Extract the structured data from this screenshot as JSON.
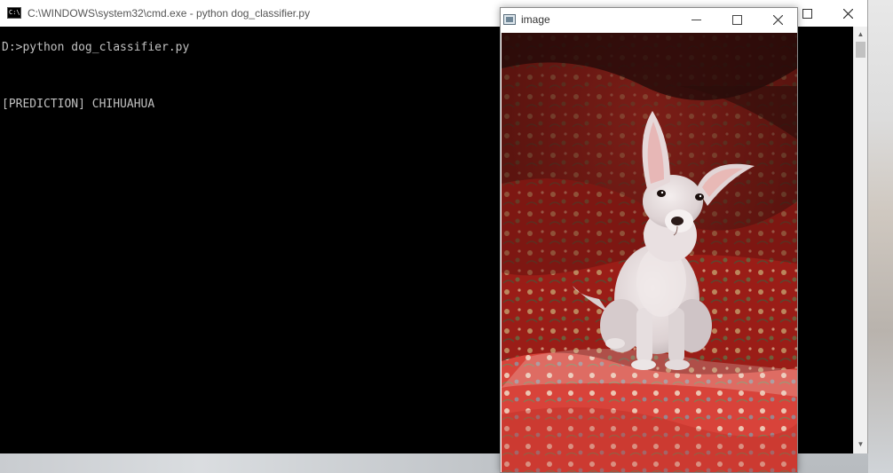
{
  "cmd_window": {
    "title": "C:\\WINDOWS\\system32\\cmd.exe - python  dog_classifier.py",
    "icon_text": "C:\\.",
    "lines": [
      "D:>python dog_classifier.py",
      "[PREDICTION] CHIHUAHUA"
    ]
  },
  "image_window": {
    "title": "image",
    "photo_subject": "chihuahua on red floral blanket"
  },
  "colors": {
    "console_bg": "#000000",
    "console_text": "#c0c0c0",
    "blanket_red": "#9e1c17"
  }
}
